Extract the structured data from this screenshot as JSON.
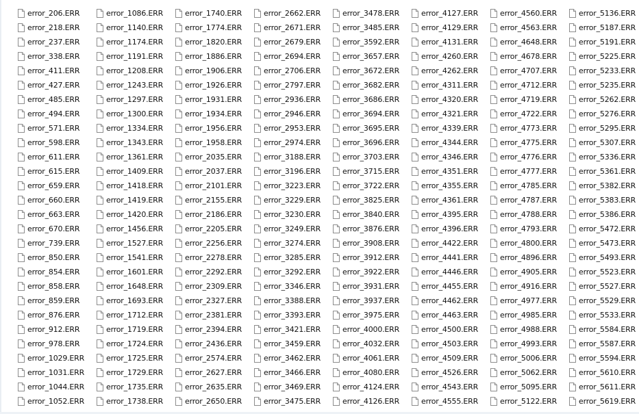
{
  "icon": "document-icon",
  "columns": [
    [
      "error_206.ERR",
      "error_218.ERR",
      "error_237.ERR",
      "error_338.ERR",
      "error_411.ERR",
      "error_427.ERR",
      "error_485.ERR",
      "error_494.ERR",
      "error_571.ERR",
      "error_598.ERR",
      "error_611.ERR",
      "error_615.ERR",
      "error_659.ERR",
      "error_660.ERR",
      "error_663.ERR",
      "error_670.ERR",
      "error_739.ERR",
      "error_850.ERR",
      "error_854.ERR",
      "error_858.ERR",
      "error_859.ERR",
      "error_876.ERR",
      "error_912.ERR",
      "error_978.ERR",
      "error_1029.ERR",
      "error_1031.ERR",
      "error_1044.ERR",
      "error_1052.ERR"
    ],
    [
      "error_1086.ERR",
      "error_1140.ERR",
      "error_1174.ERR",
      "error_1191.ERR",
      "error_1208.ERR",
      "error_1243.ERR",
      "error_1297.ERR",
      "error_1300.ERR",
      "error_1334.ERR",
      "error_1343.ERR",
      "error_1361.ERR",
      "error_1409.ERR",
      "error_1418.ERR",
      "error_1419.ERR",
      "error_1420.ERR",
      "error_1456.ERR",
      "error_1527.ERR",
      "error_1541.ERR",
      "error_1601.ERR",
      "error_1648.ERR",
      "error_1693.ERR",
      "error_1712.ERR",
      "error_1719.ERR",
      "error_1724.ERR",
      "error_1725.ERR",
      "error_1729.ERR",
      "error_1735.ERR",
      "error_1738.ERR"
    ],
    [
      "error_1740.ERR",
      "error_1774.ERR",
      "error_1820.ERR",
      "error_1886.ERR",
      "error_1906.ERR",
      "error_1926.ERR",
      "error_1931.ERR",
      "error_1934.ERR",
      "error_1956.ERR",
      "error_1958.ERR",
      "error_2035.ERR",
      "error_2037.ERR",
      "error_2101.ERR",
      "error_2155.ERR",
      "error_2186.ERR",
      "error_2205.ERR",
      "error_2256.ERR",
      "error_2278.ERR",
      "error_2292.ERR",
      "error_2309.ERR",
      "error_2327.ERR",
      "error_2381.ERR",
      "error_2394.ERR",
      "error_2436.ERR",
      "error_2574.ERR",
      "error_2627.ERR",
      "error_2635.ERR",
      "error_2650.ERR"
    ],
    [
      "error_2662.ERR",
      "error_2671.ERR",
      "error_2679.ERR",
      "error_2694.ERR",
      "error_2706.ERR",
      "error_2797.ERR",
      "error_2936.ERR",
      "error_2946.ERR",
      "error_2953.ERR",
      "error_2974.ERR",
      "error_3188.ERR",
      "error_3196.ERR",
      "error_3223.ERR",
      "error_3229.ERR",
      "error_3230.ERR",
      "error_3249.ERR",
      "error_3274.ERR",
      "error_3285.ERR",
      "error_3292.ERR",
      "error_3346.ERR",
      "error_3388.ERR",
      "error_3393.ERR",
      "error_3421.ERR",
      "error_3459.ERR",
      "error_3462.ERR",
      "error_3466.ERR",
      "error_3469.ERR",
      "error_3475.ERR"
    ],
    [
      "error_3478.ERR",
      "error_3485.ERR",
      "error_3592.ERR",
      "error_3657.ERR",
      "error_3672.ERR",
      "error_3682.ERR",
      "error_3686.ERR",
      "error_3694.ERR",
      "error_3695.ERR",
      "error_3696.ERR",
      "error_3703.ERR",
      "error_3715.ERR",
      "error_3722.ERR",
      "error_3825.ERR",
      "error_3840.ERR",
      "error_3876.ERR",
      "error_3908.ERR",
      "error_3912.ERR",
      "error_3922.ERR",
      "error_3931.ERR",
      "error_3937.ERR",
      "error_3975.ERR",
      "error_4000.ERR",
      "error_4032.ERR",
      "error_4061.ERR",
      "error_4080.ERR",
      "error_4124.ERR",
      "error_4126.ERR"
    ],
    [
      "error_4127.ERR",
      "error_4129.ERR",
      "error_4131.ERR",
      "error_4260.ERR",
      "error_4262.ERR",
      "error_4311.ERR",
      "error_4320.ERR",
      "error_4321.ERR",
      "error_4339.ERR",
      "error_4344.ERR",
      "error_4346.ERR",
      "error_4351.ERR",
      "error_4355.ERR",
      "error_4361.ERR",
      "error_4395.ERR",
      "error_4396.ERR",
      "error_4422.ERR",
      "error_4441.ERR",
      "error_4446.ERR",
      "error_4455.ERR",
      "error_4462.ERR",
      "error_4463.ERR",
      "error_4500.ERR",
      "error_4503.ERR",
      "error_4509.ERR",
      "error_4526.ERR",
      "error_4543.ERR",
      "error_4555.ERR"
    ],
    [
      "error_4560.ERR",
      "error_4563.ERR",
      "error_4648.ERR",
      "error_4678.ERR",
      "error_4707.ERR",
      "error_4712.ERR",
      "error_4719.ERR",
      "error_4722.ERR",
      "error_4773.ERR",
      "error_4775.ERR",
      "error_4776.ERR",
      "error_4777.ERR",
      "error_4785.ERR",
      "error_4787.ERR",
      "error_4788.ERR",
      "error_4793.ERR",
      "error_4800.ERR",
      "error_4896.ERR",
      "error_4905.ERR",
      "error_4916.ERR",
      "error_4977.ERR",
      "error_4985.ERR",
      "error_4988.ERR",
      "error_4993.ERR",
      "error_5006.ERR",
      "error_5062.ERR",
      "error_5095.ERR",
      "error_5122.ERR"
    ],
    [
      "error_5136.ERR",
      "error_5187.ERR",
      "error_5191.ERR",
      "error_5225.ERR",
      "error_5233.ERR",
      "error_5235.ERR",
      "error_5262.ERR",
      "error_5276.ERR",
      "error_5295.ERR",
      "error_5307.ERR",
      "error_5336.ERR",
      "error_5361.ERR",
      "error_5382.ERR",
      "error_5383.ERR",
      "error_5386.ERR",
      "error_5472.ERR",
      "error_5473.ERR",
      "error_5493.ERR",
      "error_5523.ERR",
      "error_5527.ERR",
      "error_5529.ERR",
      "error_5533.ERR",
      "error_5584.ERR",
      "error_5587.ERR",
      "error_5594.ERR",
      "error_5610.ERR",
      "error_5611.ERR",
      "error_5619.ERR"
    ]
  ]
}
